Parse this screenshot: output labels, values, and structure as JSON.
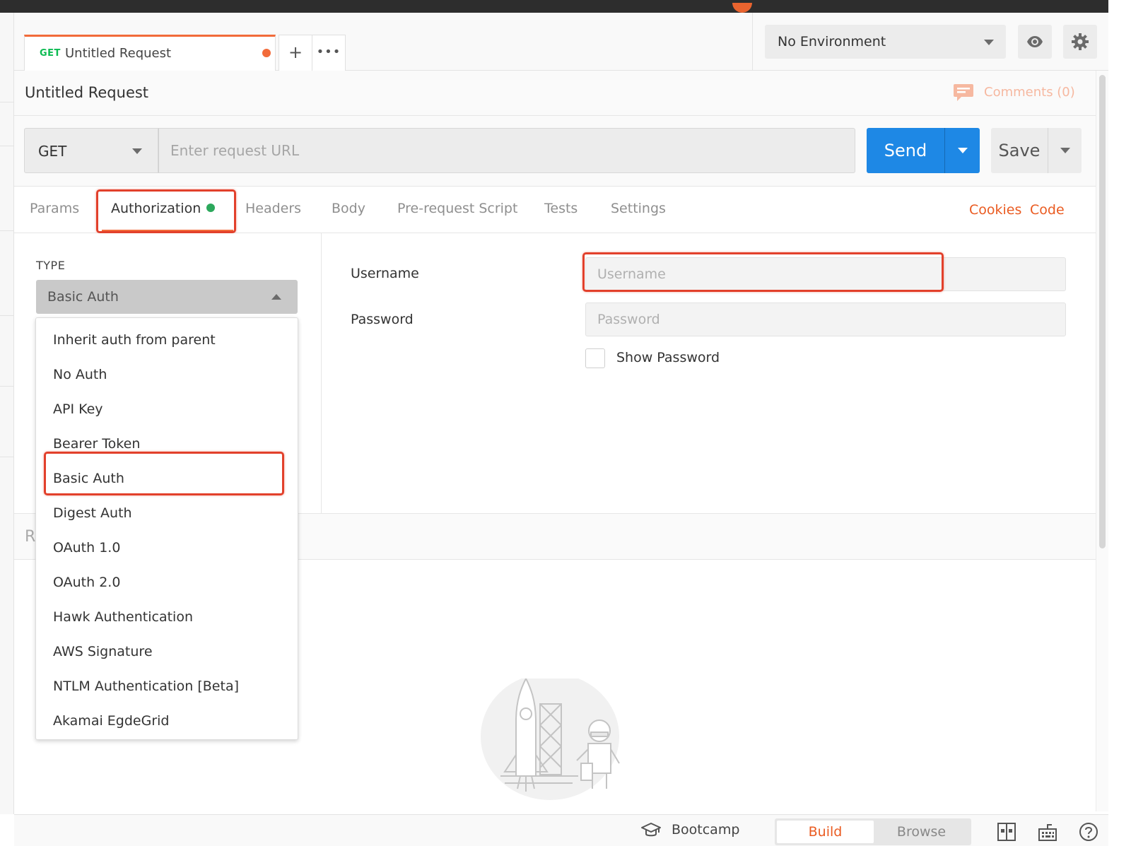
{
  "request_tab": {
    "method": "GET",
    "name": "Untitled Request",
    "new_tab_glyph": "+",
    "more_glyph": "•••"
  },
  "environment": {
    "selected": "No Environment",
    "eye_icon": "eye-icon",
    "settings_icon": "gear-icon"
  },
  "request": {
    "title": "Untitled Request",
    "comments_label": "Comments (0)",
    "method": "GET",
    "url_placeholder": "Enter request URL",
    "url_value": "",
    "send_label": "Send",
    "save_label": "Save"
  },
  "tabs": {
    "items": [
      "Params",
      "Authorization",
      "Headers",
      "Body",
      "Pre-request Script",
      "Tests",
      "Settings"
    ],
    "active": "Authorization",
    "cookies_label": "Cookies",
    "code_label": "Code"
  },
  "auth": {
    "type_label": "TYPE",
    "selected_type": "Basic Auth",
    "username_label": "Username",
    "username_placeholder": "Username",
    "password_label": "Password",
    "password_placeholder": "Password",
    "show_password_label": "Show Password",
    "show_password_checked": false
  },
  "auth_type_options": [
    "Inherit auth from parent",
    "No Auth",
    "API Key",
    "Bearer Token",
    "Basic Auth",
    "Digest Auth",
    "OAuth 1.0",
    "OAuth 2.0",
    "Hawk Authentication",
    "AWS Signature",
    "NTLM Authentication [Beta]",
    "Akamai EgdeGrid"
  ],
  "response": {
    "partial_label": "R"
  },
  "footer": {
    "bootcamp_label": "Bootcamp",
    "build_label": "Build",
    "browse_label": "Browse",
    "active_mode": "Build",
    "icons": [
      "two-pane-icon",
      "keyboard-icon",
      "help-icon"
    ]
  },
  "colors": {
    "accent": "#f26b3a",
    "send_blue": "#1e88e5",
    "highlight_red": "#e2402b",
    "get_green": "#0cbb52",
    "status_green": "#2ca85c"
  }
}
